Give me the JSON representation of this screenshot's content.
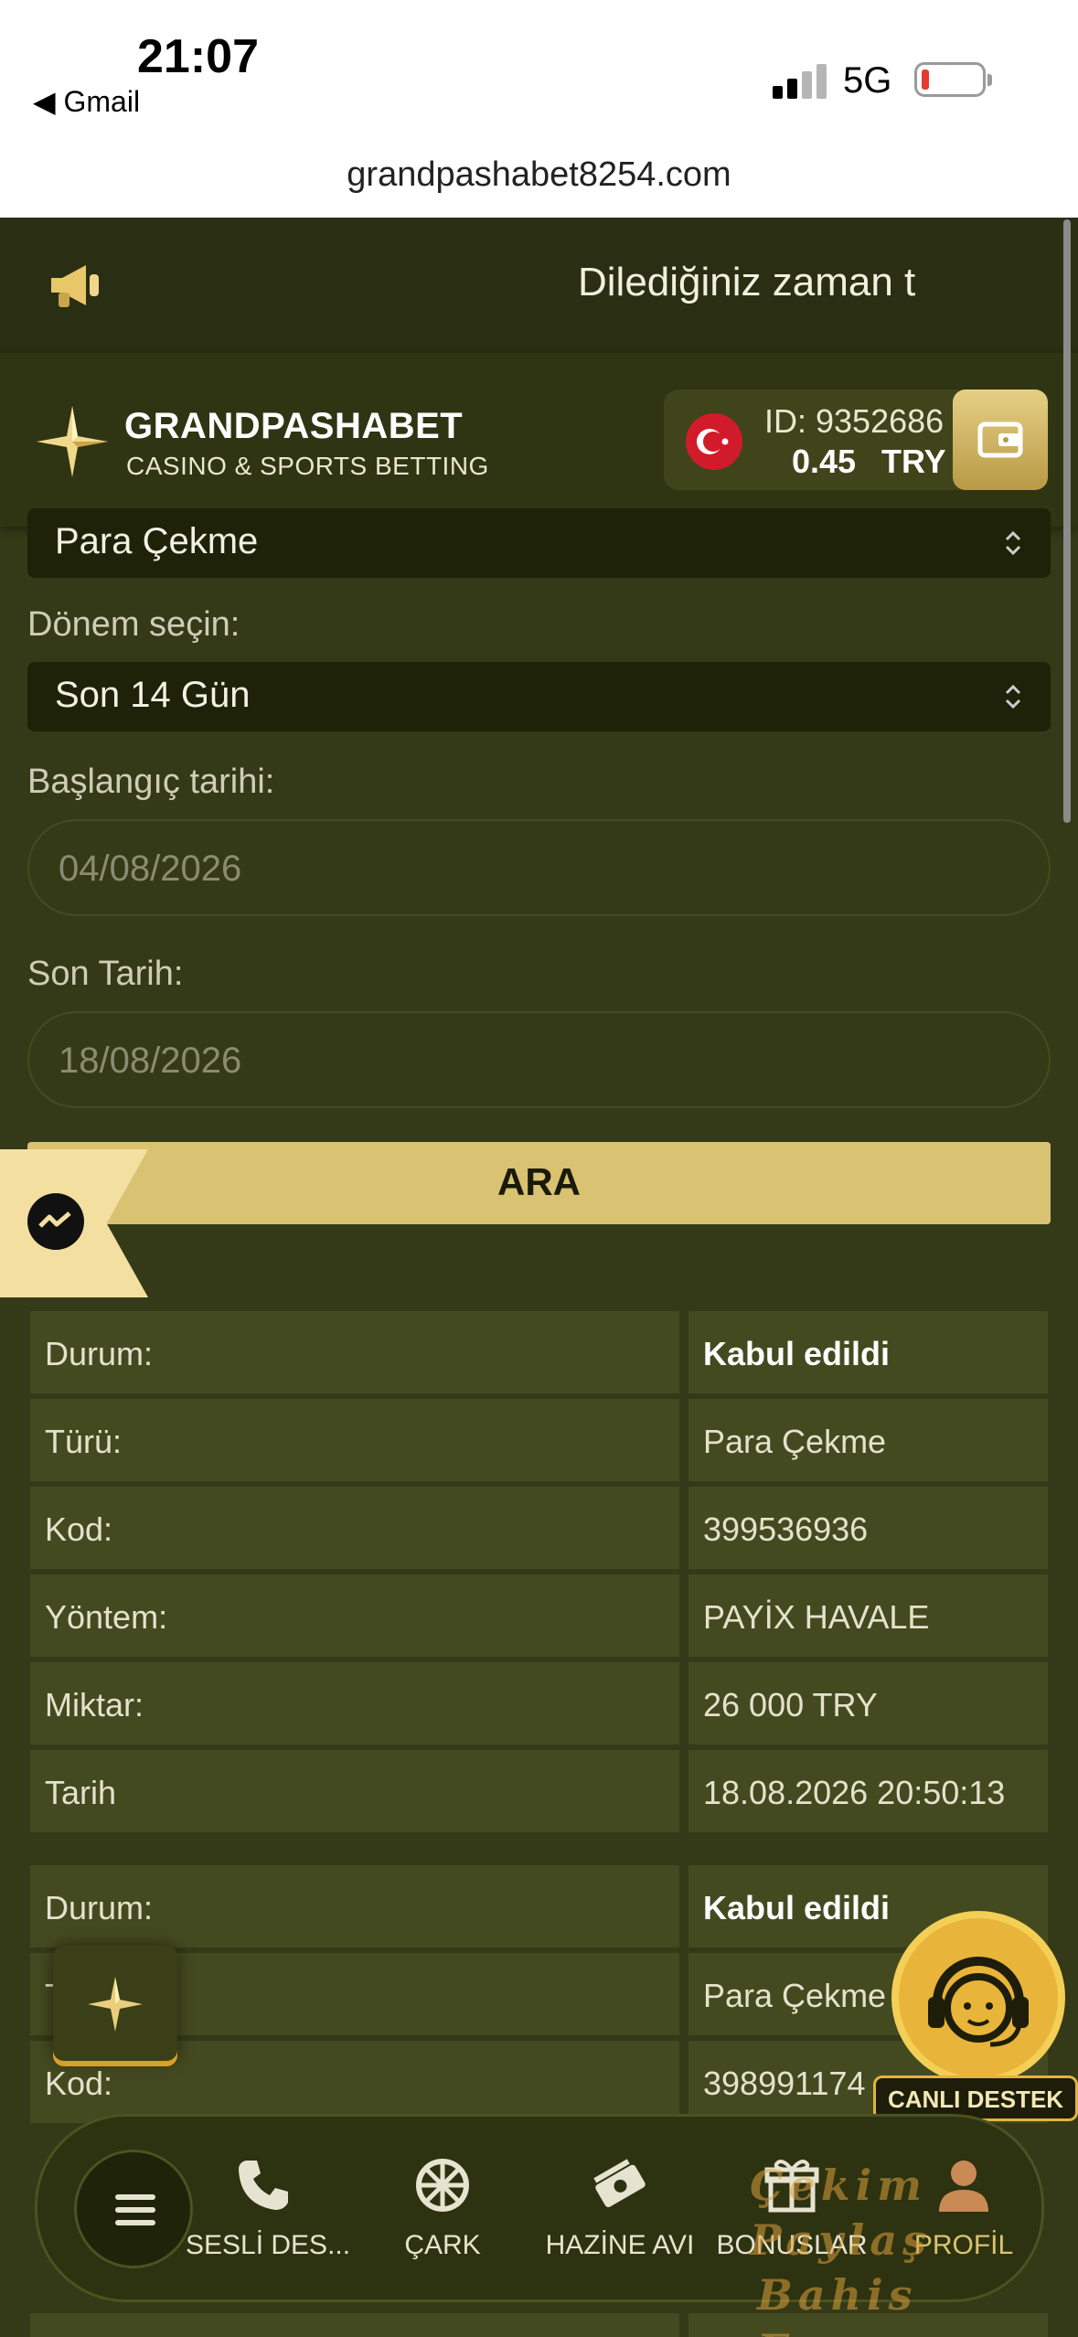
{
  "status_bar": {
    "time": "21:07",
    "back_label": "◀ Gmail",
    "network": "5G"
  },
  "browser": {
    "url": "grandpashabet8254.com"
  },
  "announcement": {
    "text": "Dilediğiniz zaman t"
  },
  "header": {
    "brand": "GRANDPASHABET",
    "tagline": "CASINO & SPORTS BETTING",
    "account_id": "ID: 9352686",
    "balance": "0.45",
    "currency": "TRY"
  },
  "filters": {
    "type_value": "Para Çekme",
    "period_label": "Dönem seçin:",
    "period_value": "Son 14 Gün",
    "start_label": "Başlangıç tarihi:",
    "start_value": "04/08/2026",
    "end_label": "Son Tarih:",
    "end_value": "18/08/2026",
    "search_label": "ARA"
  },
  "transactions": [
    {
      "rows": [
        {
          "key": "Durum:",
          "value": "Kabul edildi"
        },
        {
          "key": "Türü:",
          "value": "Para Çekme"
        },
        {
          "key": "Kod:",
          "value": "399536936"
        },
        {
          "key": "Yöntem:",
          "value": "PAYİX HAVALE"
        },
        {
          "key": "Miktar:",
          "value": "26 000 TRY"
        },
        {
          "key": "Tarih",
          "value": "18.08.2026 20:50:13"
        }
      ]
    },
    {
      "rows": [
        {
          "key": "Durum:",
          "value": "Kabul edildi"
        },
        {
          "key": "T",
          "value": "Para Çekme"
        },
        {
          "key": "Kod:",
          "value": "398991174"
        }
      ]
    }
  ],
  "live_support": {
    "label": "CANLI DESTEK"
  },
  "bottom_nav": {
    "items": [
      {
        "label": "SESLİ DES...",
        "icon": "phone-icon"
      },
      {
        "label": "ÇARK",
        "icon": "wheel-icon"
      },
      {
        "label": "HAZİNE AVI",
        "icon": "treasure-icon"
      },
      {
        "label": "BONUSLAR",
        "icon": "gift-icon"
      },
      {
        "label": "PROFİL",
        "icon": "profile-icon"
      }
    ]
  },
  "watermark": {
    "line1": "Çekim Paylaş",
    "line2": "Bahis Forum"
  },
  "colors": {
    "accent_gold": "#d9c271",
    "page_bg": "#343a17",
    "row_bg": "#444a20"
  }
}
